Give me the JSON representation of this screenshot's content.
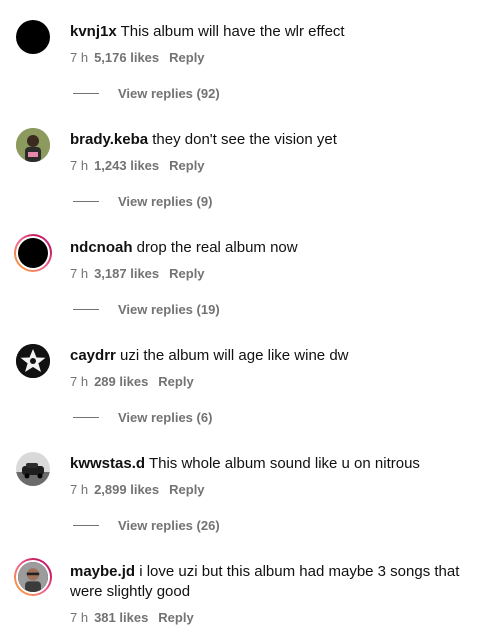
{
  "comments": [
    {
      "username": "kvnj1x",
      "text": "This album will have the wlr effect",
      "time": "7 h",
      "likes": "5,176 likes",
      "reply": "Reply",
      "view_replies": "View replies (92)",
      "avatar_icon": "black-circle"
    },
    {
      "username": "brady.keba",
      "text": "they don't see the vision yet",
      "time": "7 h",
      "likes": "1,243 likes",
      "reply": "Reply",
      "view_replies": "View replies (9)",
      "avatar_icon": "person-photo"
    },
    {
      "username": "ndcnoah",
      "text": "drop the real album now",
      "time": "7 h",
      "likes": "3,187 likes",
      "reply": "Reply",
      "view_replies": "View replies (19)",
      "avatar_icon": "black-circle-story-ring"
    },
    {
      "username": "caydrr",
      "text": "uzi the album will age like wine dw",
      "time": "7 h",
      "likes": "289 likes",
      "reply": "Reply",
      "view_replies": "View replies (6)",
      "avatar_icon": "star-emblem"
    },
    {
      "username": "kwwstas.d",
      "text": "This whole album sound like u on nitrous",
      "time": "7 h",
      "likes": "2,899 likes",
      "reply": "Reply",
      "view_replies": "View replies (26)",
      "avatar_icon": "car-photo"
    },
    {
      "username": "maybe.jd",
      "text": "i love uzi but this album had maybe 3 songs that were slightly good",
      "time": "7 h",
      "likes": "381 likes",
      "reply": "Reply",
      "avatar_icon": "person-photo-story-ring"
    }
  ]
}
